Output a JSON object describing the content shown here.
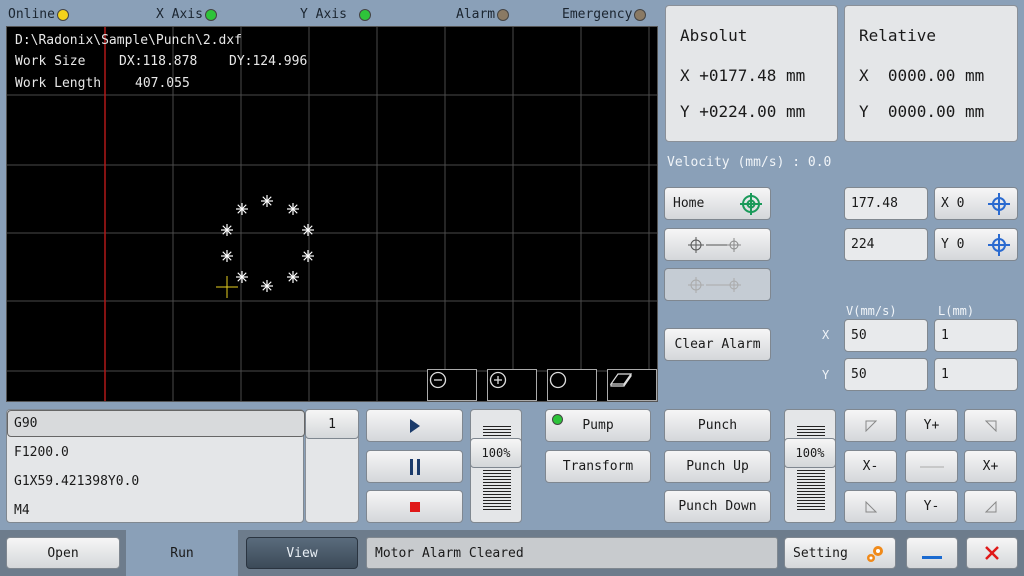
{
  "status": {
    "online": "Online",
    "x_axis": "X Axis",
    "y_axis": "Y Axis",
    "alarm": "Alarm",
    "emergency": "Emergency",
    "colors": {
      "online": "#f3d21a",
      "x_axis": "#2ec43a",
      "y_axis": "#2ec43a",
      "alarm": "#8a7a64",
      "emergency": "#8a7a64"
    }
  },
  "canvas": {
    "file": "D:\\Radonix\\Sample\\Punch\\2.dxf",
    "work_size_label": "Work Size",
    "dx": "DX:118.878",
    "dy": "DY:124.996",
    "work_length_label": "Work Length",
    "work_length": "407.055",
    "zoom_buttons": [
      "zoom-out-icon",
      "zoom-in-icon",
      "circle-icon",
      "eraser-icon"
    ]
  },
  "absolut": {
    "title": "Absolut",
    "x": "X +0177.48 mm",
    "y": "Y +0224.00 mm"
  },
  "relative": {
    "title": "Relative",
    "x": "X  0000.00 mm",
    "y": "Y  0000.00 mm"
  },
  "velocity": "Velocity (mm/s) : 0.0",
  "controls": {
    "home": "Home",
    "x_pos": "177.48",
    "y_pos": "224",
    "x0": "X 0",
    "y0": "Y 0",
    "clear_alarm": "Clear Alarm",
    "v_header": "V(mm/s)",
    "l_header": "L(mm)",
    "x_label": "X",
    "y_label": "Y",
    "vx": "50",
    "lx": "1",
    "vy": "50",
    "ly": "1"
  },
  "gcode": {
    "lines": [
      "G90",
      "F1200.0",
      "G1X59.421398Y0.0",
      "M4"
    ],
    "line_number": "1"
  },
  "feed_override": "100%",
  "punch_override": "100%",
  "actions": {
    "pump": "Pump",
    "transform": "Transform",
    "punch": "Punch",
    "punch_up": "Punch Up",
    "punch_down": "Punch Down"
  },
  "jog": {
    "y_plus": "Y+",
    "y_minus": "Y-",
    "x_minus": "X-",
    "x_plus": "X+"
  },
  "bottom": {
    "open": "Open",
    "run": "Run",
    "view": "View",
    "message": "Motor Alarm Cleared",
    "setting": "Setting"
  }
}
